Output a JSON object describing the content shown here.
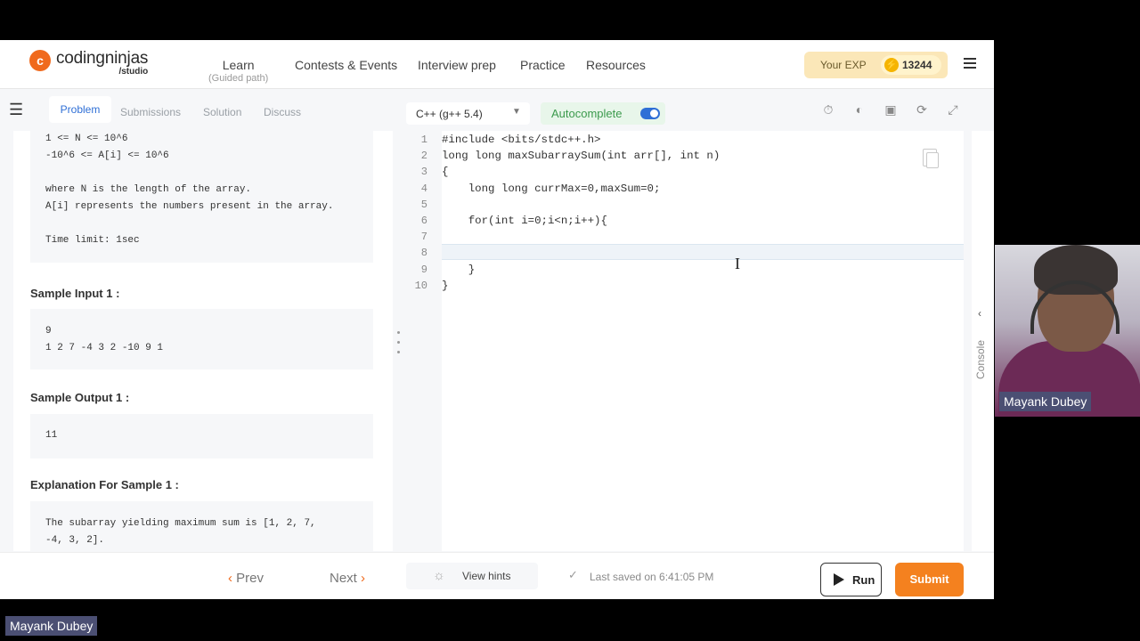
{
  "header": {
    "logo_mark": "c",
    "logo_name": "codingninjas",
    "logo_sub": "/studio",
    "nav": [
      {
        "label": "Learn",
        "sub": "(Guided path)"
      },
      {
        "label": "Contests & Events"
      },
      {
        "label": "Interview prep"
      },
      {
        "label": "Practice"
      },
      {
        "label": "Resources"
      }
    ],
    "exp_label": "Your EXP",
    "exp_value": "13244"
  },
  "problem_tabs": [
    "Problem",
    "Submissions",
    "Solution",
    "Discuss"
  ],
  "problem": {
    "constraints_lines": [
      "1 <= N <= 10^6",
      "-10^6 <= A[i] <= 10^6",
      "",
      "where N is the length of the array.",
      "A[i] represents the numbers present in the array.",
      "",
      "Time limit: 1sec"
    ],
    "sample_input_title": "Sample Input 1 :",
    "sample_input_lines": [
      "9",
      "1 2 7 -4 3 2 -10 9 1"
    ],
    "sample_output_title": "Sample Output 1 :",
    "sample_output_lines": [
      "11"
    ],
    "explanation_title": "Explanation For Sample 1 :",
    "explanation_lines": [
      "The subarray yielding maximum sum is [1, 2, 7,",
      "-4, 3, 2]."
    ]
  },
  "editor_toolbar": {
    "language": "C++ (g++ 5.4)",
    "autocomplete_label": "Autocomplete",
    "autocomplete_on": true,
    "icons": [
      "timer-icon",
      "theme-icon",
      "save-icon",
      "reset-icon",
      "fullscreen-icon"
    ]
  },
  "editor": {
    "line_numbers": [
      "1",
      "2",
      "3",
      "4",
      "5",
      "6",
      "7",
      "8",
      "9",
      "10"
    ],
    "lines": [
      "#include <bits/stdc++.h>",
      "long long maxSubarraySum(int arr[], int n)",
      "{",
      "    long long currMax=0,maxSum=0;",
      "",
      "    for(int i=0;i<n;i++){",
      "",
      "",
      "    }",
      "}"
    ],
    "current_line": 8
  },
  "console_label": "Console",
  "footer": {
    "prev_label": "Prev",
    "next_label": "Next",
    "hints_label": "View hints",
    "saved_text": "Last saved on 6:41:05 PM",
    "run_label": "Run",
    "submit_label": "Submit"
  },
  "webcam": {
    "name": "Mayank Dubey"
  },
  "bottom_name": "Mayank Dubey",
  "colors": {
    "brand_orange": "#f06a1d",
    "submit_orange": "#f4811f",
    "active_tab_blue": "#2f6fd6",
    "autocomplete_green": "#3c9a4d",
    "exp_bg": "#fbe7b8"
  }
}
